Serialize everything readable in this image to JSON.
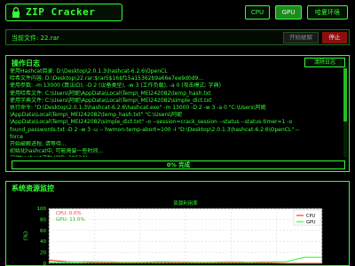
{
  "header": {
    "app_title": "ZIP Cracker",
    "cpu_label": "CPU",
    "gpu_label": "GPU",
    "mode_label": "哈夏环境"
  },
  "filebar": {
    "file_label": "当前文件: 22.rar",
    "start_label": "开始破解",
    "stop_label": "停止"
  },
  "log": {
    "title": "操作日志",
    "clear_label": "清除日志",
    "lines": [
      "使用Hashcat目录: D:\\Desktop\\2.0.1.3\\hashcat-6.2.6\\OpenCL",
      "哈希文件内容: D:\\Desktop\\22.rar:$rar5$16$f15a15362b9a66e7ee9d0d9...",
      "使用参数: -m 13000 (算法ID), -D 2 (设备类型), -w 3 (工作负载), -a 0 (攻击模式: 字典)",
      "使用哈希文件: C:\\Users\\阿妮\\AppData\\Local\\Temp\\_MEI242082\\temp_hash.txt",
      "使用字典文件: C:\\Users\\阿妮\\AppData\\Local\\Temp\\_MEI242082\\simple_dict.txt",
      "执行命令: \"D:\\Desktop\\2.0.1.3\\hashcat-6.2.6\\hashcat.exe\" -m 13000 -D 2 -w 3 -a 0 \"C:\\Users\\阿妮",
      "\\AppData\\Local\\Temp\\_MEI242082\\temp_hash.txt\" \"C:\\Users\\阿妮",
      "\\AppData\\Local\\Temp\\_MEI242082\\simple_dict.txt\" -o --session=crack_session --status --status-timer=1 -o",
      "found_passwords.txt -D 2 -w 3 -u -- hwmon-temp-abort=100 -I \"D:\\Desktop\\2.0.1.3\\hashcat-6.2.6\\OpenCL\" --",
      "force",
      "开始破解进程, 请等待...",
      "初始化hashcat中, 可能需要一些时间...",
      "启动hashcat进程 (PID: 30624)"
    ],
    "progress_text": "0% 完成",
    "progress_fraction": 0.0
  },
  "monitor": {
    "title": "系统资源监控"
  },
  "chart_data": {
    "type": "line",
    "title": "资源利用率",
    "xlabel": "",
    "ylabel": "(%)",
    "xlim": [
      0,
      15
    ],
    "ylim": [
      0,
      100
    ],
    "xticks": [
      "0.0",
      "2.5",
      "5.0",
      "7.5",
      "10.0",
      "12.5",
      "15.0"
    ],
    "yticks": [
      "0",
      "20",
      "40",
      "60",
      "80",
      "100"
    ],
    "grid": true,
    "legend": "top-right",
    "annotations": [
      "CPU: 0.0%",
      "GPU: 11.0%"
    ],
    "series": [
      {
        "name": "CPU",
        "color": "#ff3333",
        "x": [
          0,
          1,
          2,
          3,
          4,
          5,
          6,
          7,
          8,
          9,
          10,
          11,
          12,
          13,
          14,
          15
        ],
        "values": [
          6,
          3,
          2,
          1,
          1,
          1,
          2,
          1,
          1,
          1,
          1,
          1,
          1,
          0,
          0,
          0
        ]
      },
      {
        "name": "GPU",
        "color": "#33ff33",
        "x": [
          0,
          1,
          2,
          3,
          4,
          5,
          6,
          7,
          8,
          9,
          10,
          11,
          12,
          13,
          14,
          15
        ],
        "values": [
          2,
          2,
          3,
          3,
          2,
          2,
          3,
          3,
          2,
          2,
          3,
          2,
          3,
          3,
          11,
          11
        ]
      }
    ]
  },
  "colors": {
    "accent": "#33ff33",
    "background": "#000000",
    "stop": "#8a1010",
    "cpu_line": "#ff3333",
    "gpu_line": "#33ff33"
  }
}
